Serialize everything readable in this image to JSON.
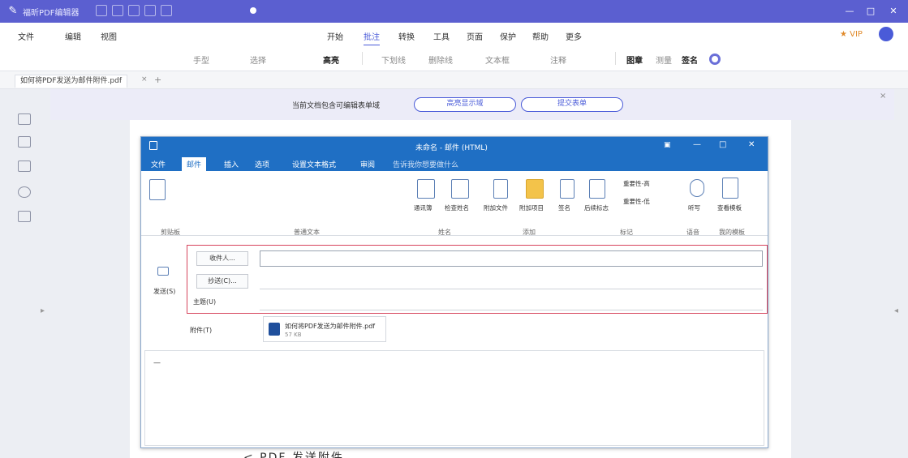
{
  "titlebar": {
    "app_title": "福昕PDF编辑器",
    "win_buttons": [
      "—",
      "□",
      "✕"
    ]
  },
  "menu": {
    "left_items": [
      "文件",
      "编辑",
      "视图"
    ],
    "tabs": [
      "开始",
      "批注",
      "转换",
      "工具",
      "页面",
      "保护",
      "帮助",
      "更多"
    ],
    "active_tab": "批注",
    "vip": "★ VIP"
  },
  "toolbar": {
    "items": [
      "手型",
      "选择",
      "高亮",
      "下划线",
      "删除线",
      "文本框",
      "注释",
      "图章",
      "测量",
      "签名",
      "附件"
    ]
  },
  "doctabs": {
    "tab_label": "如何将PDF发送为邮件附件.pdf",
    "close": "×",
    "add": "+"
  },
  "banner": {
    "text": "当前文档包含可编辑表单域",
    "btn1": "高亮显示域",
    "btn2": "提交表单",
    "close": "×"
  },
  "outlook": {
    "title": "未命名 - 邮件 (HTML)",
    "tabs": [
      "文件",
      "邮件",
      "插入",
      "选项",
      "设置文本格式",
      "审阅",
      "告诉我你想要做什么"
    ],
    "active_tab": "邮件",
    "ribbon_groups": [
      "剪贴板",
      "普通文本",
      "姓名",
      "添加",
      "标记",
      "语音",
      "我的模板"
    ],
    "ribbon_buttons": [
      "通讯簿",
      "检查姓名",
      "附加文件",
      "附加项目",
      "签名",
      "后续标志",
      "重要性-高",
      "重要性-低",
      "听写",
      "查看模板"
    ],
    "send_label": "发送(S)",
    "to_label": "收件人...",
    "cc_label": "抄送(C)...",
    "subject_label": "主题(U)",
    "attach_label": "附件(T)",
    "attachment": {
      "name": "如何将PDF发送为邮件附件.pdf",
      "size": "57 KB"
    },
    "body_text": "—"
  },
  "page_bottom_text": "< PDF 发送附件"
}
